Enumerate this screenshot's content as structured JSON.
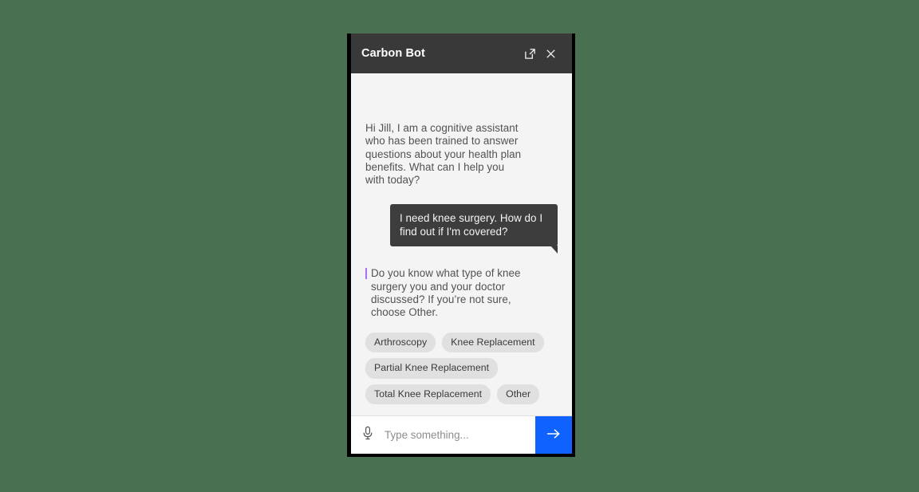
{
  "page": {
    "background_color": "#4a7052"
  },
  "widget": {
    "header": {
      "title": "Carbon Bot",
      "background_color": "#393939",
      "expand_icon": "expand-icon",
      "close_icon": "close-icon"
    },
    "messages": [
      {
        "role": "bot",
        "text": "Hi Jill, I am a cognitive assistant who has been trained to answer questions about your health plan benefits. What can I help you with today?",
        "accent": false
      },
      {
        "role": "user",
        "text": "I need knee surgery. How do I find out if I'm covered?"
      },
      {
        "role": "bot",
        "text": "Do you know what type of knee surgery you and your doctor discussed? If you’re not sure, choose Other.",
        "accent": true,
        "accent_color": "#a56eff"
      }
    ],
    "chips": [
      {
        "label": "Arthroscopy"
      },
      {
        "label": "Knee Replacement"
      },
      {
        "label": "Partial Knee Replacement"
      },
      {
        "label": "Total Knee Replacement"
      },
      {
        "label": "Other"
      }
    ],
    "input_bar": {
      "mic_icon": "microphone-icon",
      "placeholder": "Type something...",
      "value": "",
      "send_icon": "arrow-right-icon",
      "send_color": "#0f62fe"
    }
  }
}
